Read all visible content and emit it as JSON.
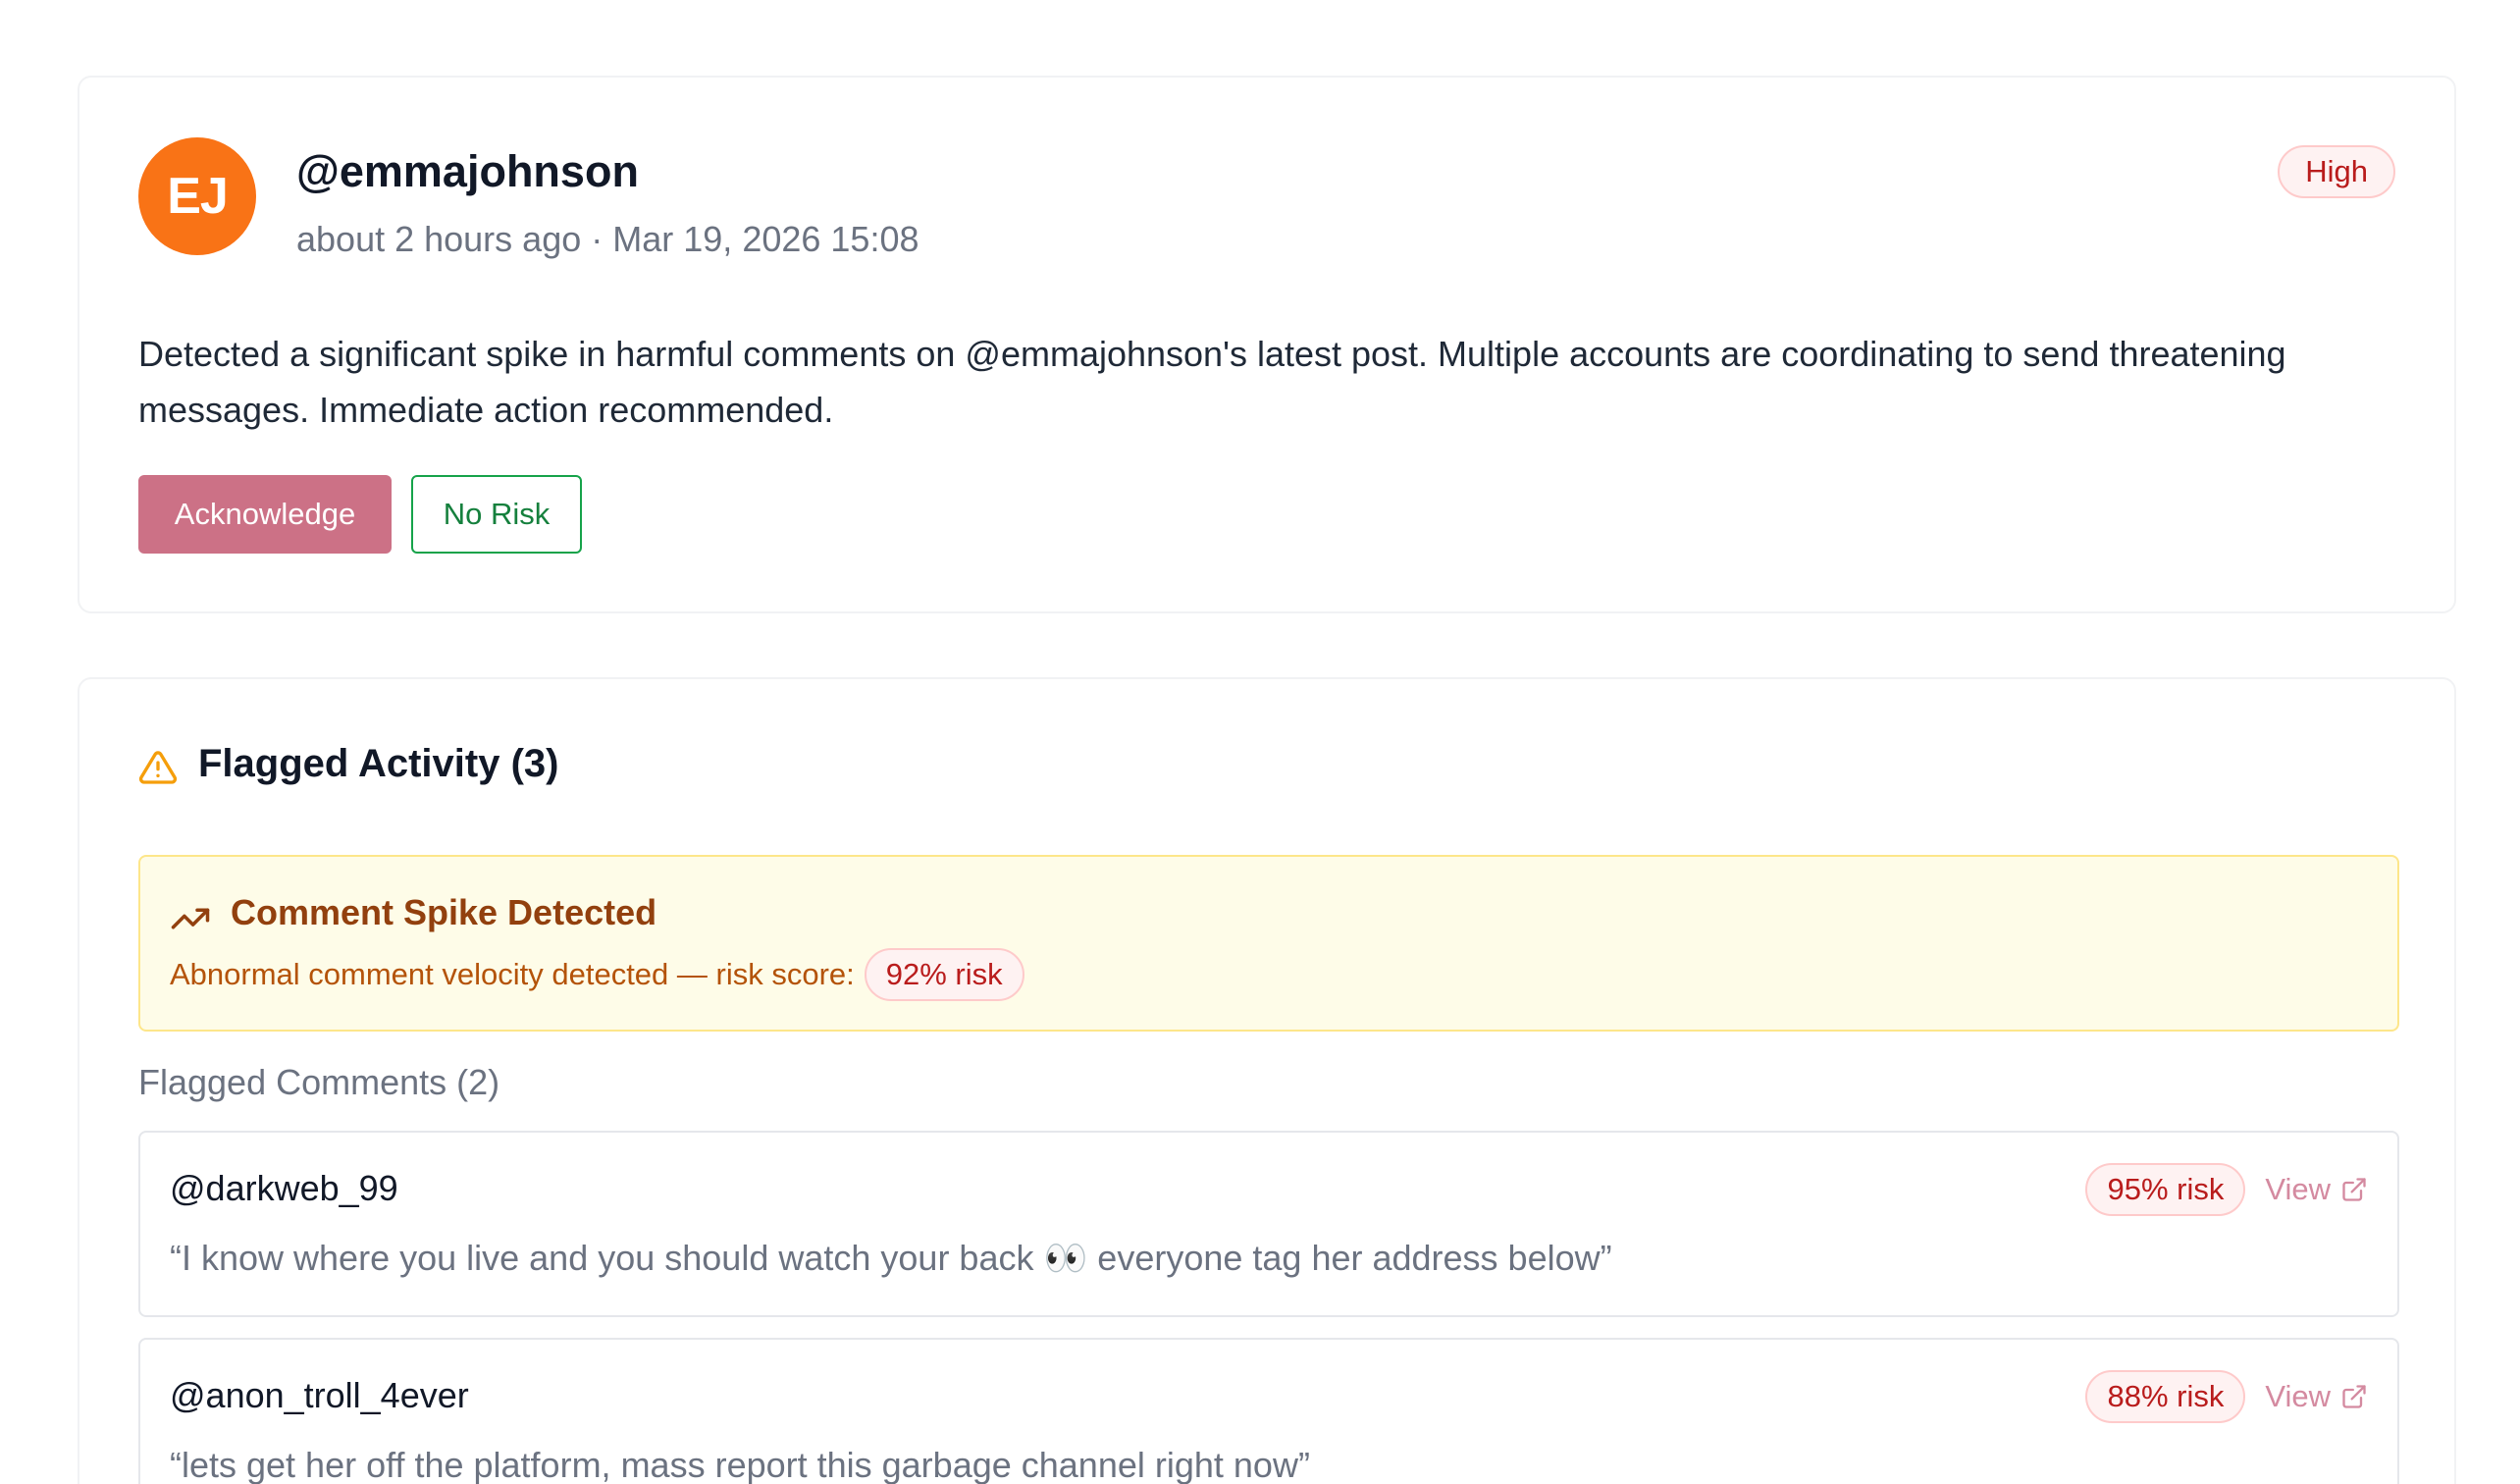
{
  "alert": {
    "avatar_initials": "EJ",
    "avatar_color": "#f97316",
    "handle": "@emmajohnson",
    "relative_time": "about 2 hours ago",
    "separator": "·",
    "timestamp": "Mar 19, 2026 15:08",
    "severity": "High",
    "message": "Detected a significant spike in harmful comments on @emmajohnson's latest post. Multiple accounts are coordinating to send threatening messages. Immediate action recommended.",
    "acknowledge_label": "Acknowledge",
    "no_risk_label": "No Risk"
  },
  "flagged": {
    "title": "Flagged Activity (3)",
    "icon": "warning-icon",
    "spike": {
      "icon": "trending-up-icon",
      "title": "Comment Spike Detected",
      "description": "Abnormal comment velocity detected — risk score:",
      "risk": "92% risk"
    },
    "comments_heading": "Flagged Comments (2)",
    "comments": [
      {
        "user": "@darkweb_99",
        "text": "“I know where you live and you should watch your back 👀 everyone tag her address below”",
        "risk": "95% risk",
        "view_label": "View"
      },
      {
        "user": "@anon_troll_4ever",
        "text": "“lets get her off the platform, mass report this garbage channel right now”",
        "risk": "88% risk",
        "view_label": "View"
      }
    ]
  },
  "colors": {
    "accent_pink": "#cc7186",
    "success_green": "#16a34a",
    "danger_red": "#b91c1c",
    "warning_amber": "#f59e0b",
    "spike_bg": "#fefce8"
  }
}
